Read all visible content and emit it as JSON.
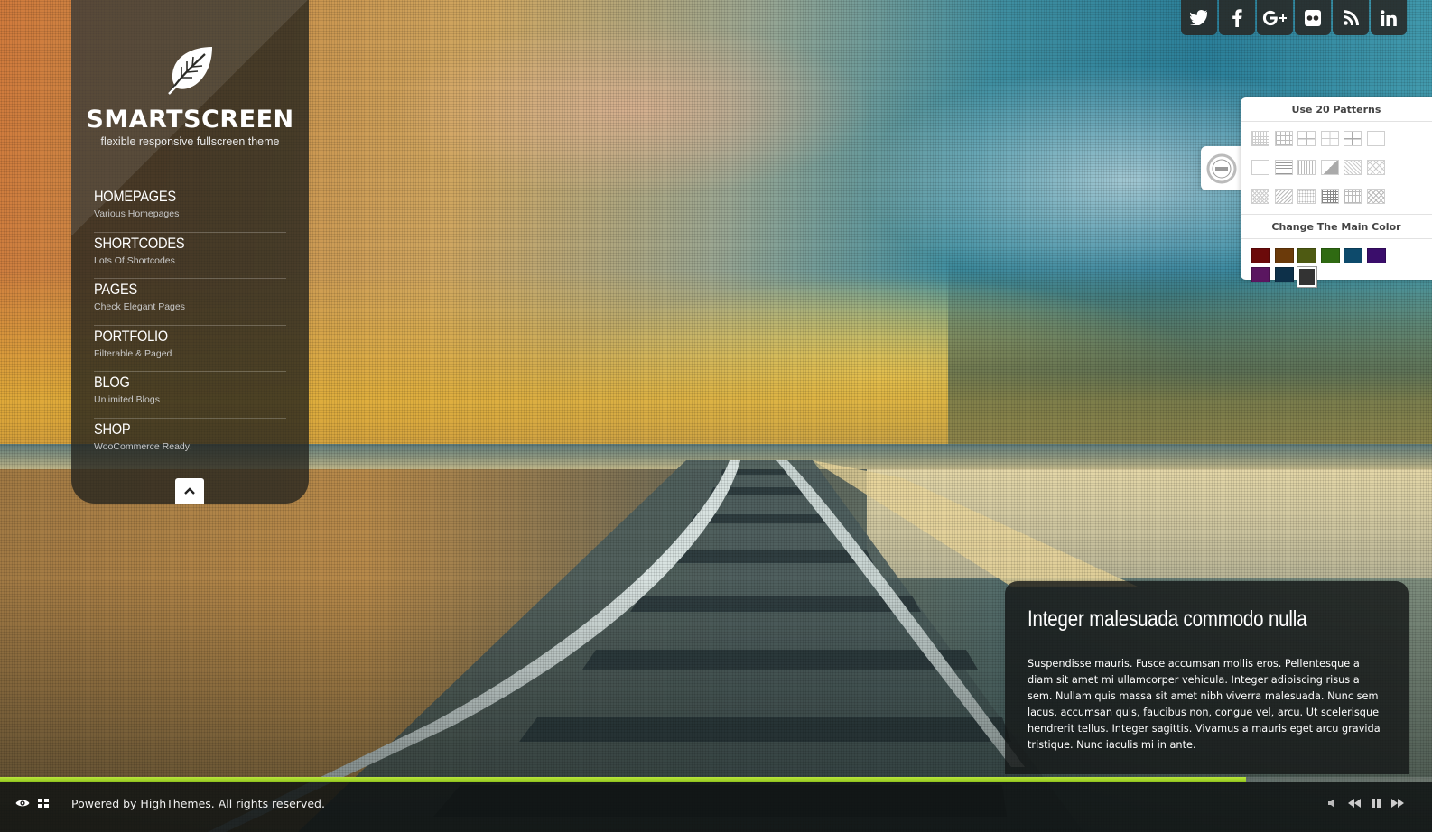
{
  "brand": {
    "name": "SMARTSCREEN",
    "tagline": "flexible responsive fullscreen theme"
  },
  "menu": [
    {
      "label": "HOMEPAGES",
      "sub": "Various Homepages"
    },
    {
      "label": "SHORTCODES",
      "sub": "Lots Of Shortcodes"
    },
    {
      "label": "PAGES",
      "sub": "Check Elegant Pages"
    },
    {
      "label": "PORTFOLIO",
      "sub": "Filterable & Paged"
    },
    {
      "label": "BLOG",
      "sub": "Unlimited Blogs"
    },
    {
      "label": "SHOP",
      "sub": "WooCommerce Ready!"
    }
  ],
  "social": [
    {
      "icon": "twitter-icon",
      "glyph": "t"
    },
    {
      "icon": "facebook-icon",
      "glyph": "f"
    },
    {
      "icon": "google-plus-icon",
      "glyph": "G+"
    },
    {
      "icon": "flickr-icon",
      "glyph": "●●"
    },
    {
      "icon": "rss-icon",
      "glyph": "rss"
    },
    {
      "icon": "linkedin-icon",
      "glyph": "in"
    }
  ],
  "switcher": {
    "patterns_heading": "Use 20 Patterns",
    "colors_heading": "Change The Main Color",
    "colors": [
      "#6b0a0a",
      "#6b3a0a",
      "#4e5a12",
      "#2f6a12",
      "#0d4a6b",
      "#3a0d6b",
      "#5a1660",
      "#0d3049",
      "#333333"
    ],
    "active_color": "#333333"
  },
  "caption": {
    "title": "Integer malesuada commodo nulla",
    "text": "Suspendisse mauris. Fusce accumsan mollis eros. Pellentesque a diam sit amet mi ullamcorper vehicula. Integer adipiscing risus a sem. Nullam quis massa sit amet nibh viverra malesuada. Nunc sem lacus, accumsan quis, faucibus non, congue vel, arcu. Ut scelerisque hendrerit tellus. Integer sagittis. Vivamus a mauris eget arcu gravida tristique. Nunc iaculis mi in ante."
  },
  "footer": {
    "copyright": "Powered by HighThemes. All rights reserved.",
    "slide_progress": 0.87,
    "accent": "#9ccc2a"
  }
}
